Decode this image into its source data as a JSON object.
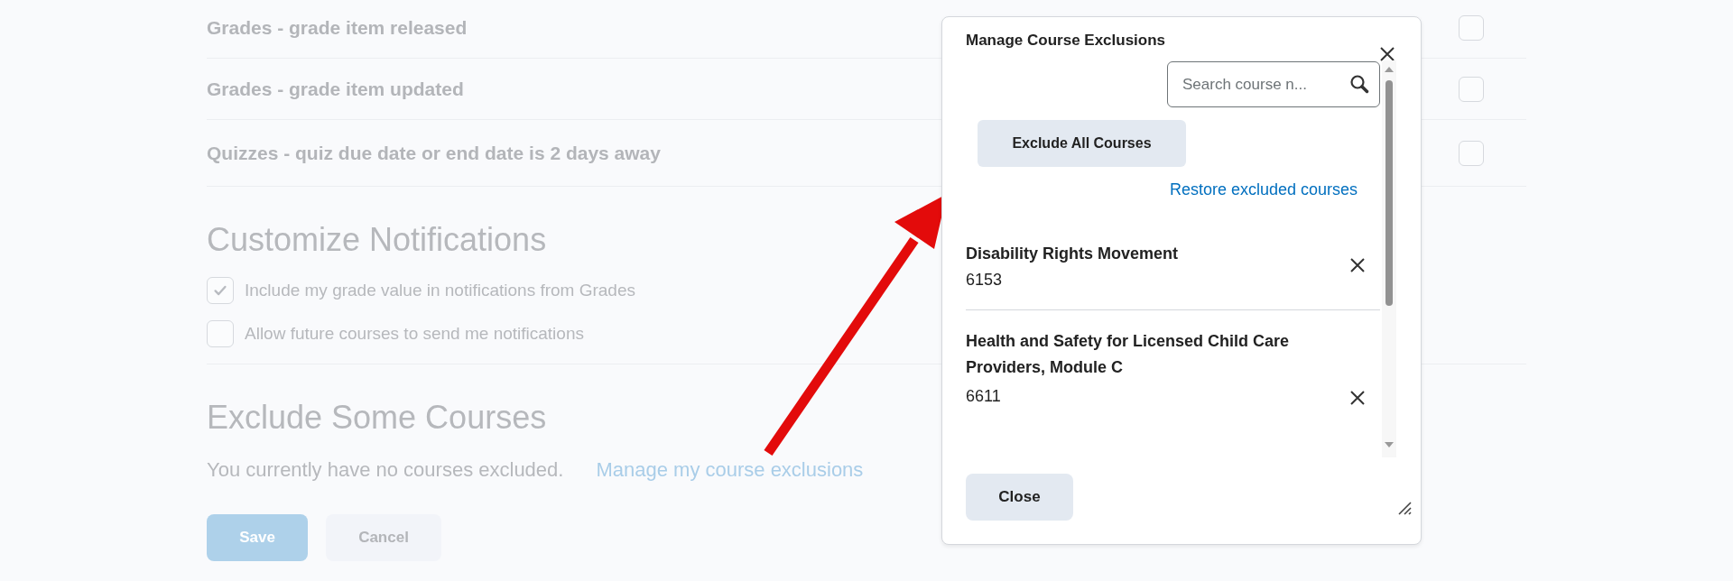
{
  "notification_rows": [
    {
      "label": "Grades - grade item released",
      "checked": false
    },
    {
      "label": "Grades - grade item updated",
      "checked": false
    },
    {
      "label": "Quizzes - quiz due date or end date is 2 days away",
      "checked": false
    }
  ],
  "customize": {
    "title": "Customize Notifications",
    "options": [
      {
        "label": "Include my grade value in notifications from Grades",
        "checked": true
      },
      {
        "label": "Allow future courses to send me notifications",
        "checked": false
      }
    ]
  },
  "exclude": {
    "title": "Exclude Some Courses",
    "status": "You currently have no courses excluded.",
    "link": "Manage my course exclusions"
  },
  "buttons": [
    {
      "label": "Save",
      "kind": "primary"
    },
    {
      "label": "Cancel",
      "kind": "secondary"
    }
  ],
  "dialog": {
    "title": "Manage Course Exclusions",
    "search": {
      "placeholder": "Search course n..."
    },
    "exclude_all": "Exclude All Courses",
    "restore": "Restore excluded courses",
    "courses": [
      {
        "name": "Disability Rights Movement",
        "code": "6153"
      },
      {
        "name": "Health and Safety for Licensed Child Care Providers, Module C",
        "code": "6611"
      }
    ],
    "close": "Close"
  }
}
